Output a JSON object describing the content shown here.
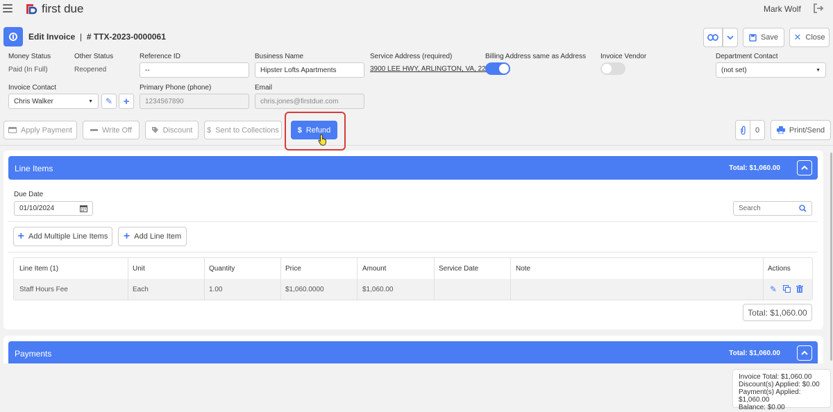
{
  "app": {
    "name": "first due",
    "user": "Mark Wolf"
  },
  "header": {
    "title": "Edit Invoice",
    "separator": "|",
    "invoice_number": "# TTX-2023-0000061",
    "save_label": "Save",
    "close_label": "Close"
  },
  "fields": {
    "money_status": {
      "label": "Money Status",
      "value": "Paid (In Full)"
    },
    "other_status": {
      "label": "Other Status",
      "value": "Reopened"
    },
    "reference_id": {
      "label": "Reference ID",
      "value": "--"
    },
    "business_name": {
      "label": "Business Name",
      "value": "Hipster Lofts Apartments"
    },
    "service_address": {
      "label": "Service Address (required)",
      "value": "3900 LEE HWY, ARLINGTON, VA, 22..."
    },
    "billing_same": {
      "label": "Billing Address same as Address",
      "enabled": true
    },
    "invoice_vendor": {
      "label": "Invoice Vendor",
      "enabled": false
    },
    "department_contact": {
      "label": "Department Contact",
      "value": "(not set)"
    },
    "invoice_contact": {
      "label": "Invoice Contact",
      "value": "Chris Walker"
    },
    "primary_phone": {
      "label": "Primary Phone (phone)",
      "value": "1234567890"
    },
    "email": {
      "label": "Email",
      "value": "chris.jones@firstdue.com"
    }
  },
  "actions": {
    "apply_payment": "Apply Payment",
    "write_off": "Write Off",
    "discount": "Discount",
    "sent_to_collections": "Sent to Collections",
    "refund": "Refund",
    "attachments_count": "0",
    "print_send": "Print/Send"
  },
  "line_items": {
    "title": "Line Items",
    "total": "Total: $1,060.00",
    "due_date_label": "Due Date",
    "due_date": "01/10/2024",
    "search_placeholder": "Search",
    "add_multiple": "Add Multiple Line Items",
    "add_single": "Add Line Item",
    "columns": [
      "Line Item (1)",
      "Unit",
      "Quantity",
      "Price",
      "Amount",
      "Service Date",
      "Note",
      "Actions"
    ],
    "rows": [
      {
        "line_item": "Staff Hours Fee",
        "unit": "Each",
        "quantity": "1.00",
        "price": "$1,060.0000",
        "amount": "$1,060.00",
        "service_date": "",
        "note": ""
      }
    ],
    "footer_total": "Total: $1,060.00"
  },
  "payments": {
    "title": "Payments",
    "total": "Total: $1,060.00"
  },
  "summary": {
    "invoice_total": "Invoice Total: $1,060.00",
    "discounts": "Discount(s) Applied: $0.00",
    "payments": "Payment(s) Applied: $1,060.00",
    "balance": "Balance: $0.00"
  },
  "colors": {
    "accent": "#4a7cf3",
    "highlight": "#d83a3a",
    "brand_red": "#d9363e"
  }
}
